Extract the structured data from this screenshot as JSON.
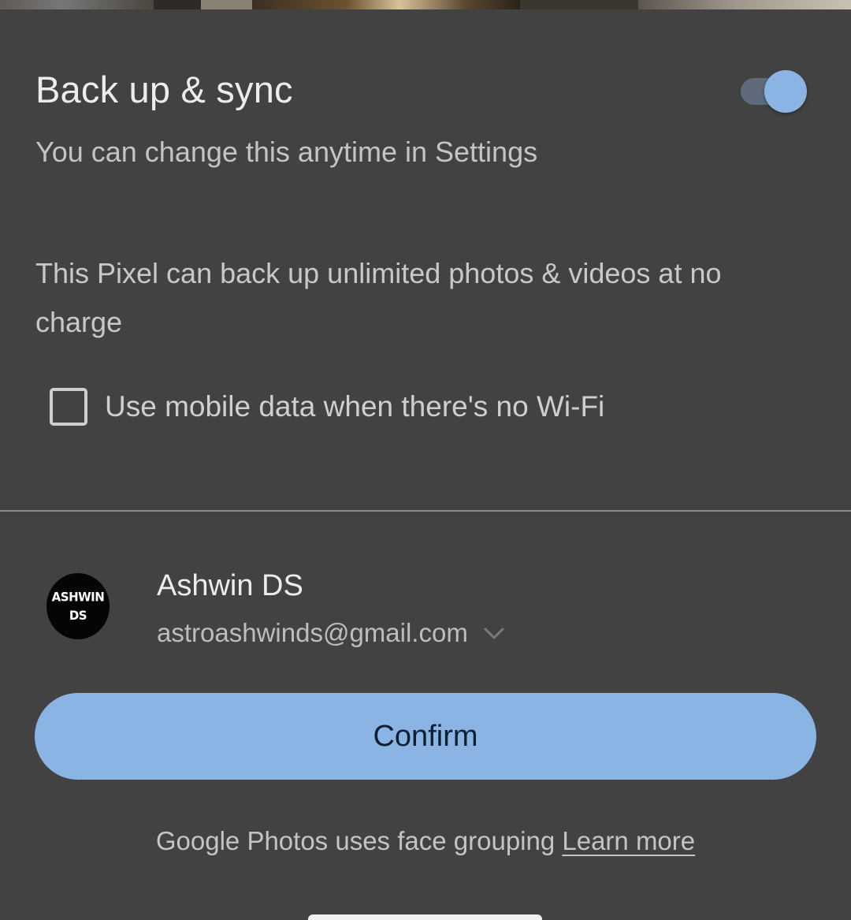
{
  "backup": {
    "title": "Back up & sync",
    "subtitle": "You can change this anytime in Settings",
    "toggle_state": "on"
  },
  "info": {
    "text": "This Pixel can back up unlimited photos & videos at no charge"
  },
  "mobile_data": {
    "label": "Use mobile data when there's no Wi-Fi",
    "checked": false
  },
  "account": {
    "avatar_line1": "ASHWIN",
    "avatar_line2": "DS",
    "name": "Ashwin DS",
    "email": "astroashwinds@gmail.com",
    "dropdown_icon": "chevron-down-icon"
  },
  "actions": {
    "confirm_label": "Confirm"
  },
  "footer": {
    "text": "Google Photos uses face grouping",
    "link": "Learn more"
  },
  "colors": {
    "sheet_background": "#424242",
    "accent": "#8ab4e3",
    "toggle_track": "#5f6b7a",
    "confirm_text": "#0f1f33"
  }
}
